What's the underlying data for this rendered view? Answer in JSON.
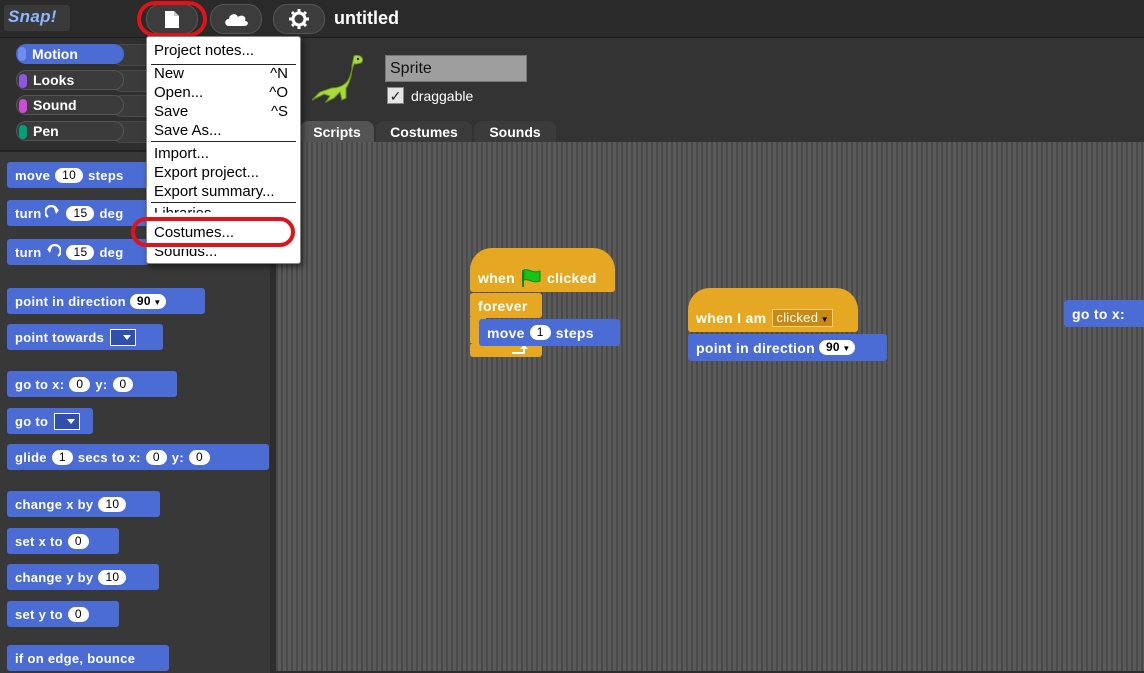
{
  "app": {
    "logo": "Snap!",
    "project_title": "untitled"
  },
  "categories": [
    {
      "label": "Motion",
      "color": "#4a6cd4"
    },
    {
      "label": "Looks",
      "color": "#8f56e3"
    },
    {
      "label": "Sound",
      "color": "#cf4ad9"
    },
    {
      "label": "Pen",
      "color": "#00a178"
    }
  ],
  "palette": {
    "move": {
      "a": "move",
      "n": "10",
      "b": "steps"
    },
    "turn_cw": {
      "a": "turn",
      "n": "15",
      "b": "deg"
    },
    "turn_ccw": {
      "a": "turn",
      "n": "15",
      "b": "deg"
    },
    "point_dir": {
      "a": "point in direction",
      "n": "90"
    },
    "point_towards": {
      "a": "point towards"
    },
    "goto_xy": {
      "a": "go to x:",
      "x": "0",
      "b": "y:",
      "y": "0"
    },
    "goto": {
      "a": "go to"
    },
    "glide": {
      "a": "glide",
      "s": "1",
      "b": "secs to x:",
      "x": "0",
      "c": "y:",
      "y": "0"
    },
    "change_x": {
      "a": "change x by",
      "n": "10"
    },
    "set_x": {
      "a": "set x to",
      "n": "0"
    },
    "change_y": {
      "a": "change y by",
      "n": "10"
    },
    "set_y": {
      "a": "set y to",
      "n": "0"
    },
    "bounce": {
      "a": "if on edge, bounce"
    }
  },
  "sprite": {
    "name": "Sprite",
    "draggable_label": "draggable",
    "draggable_checked": "✓"
  },
  "tabs": [
    "Scripts",
    "Costumes",
    "Sounds"
  ],
  "scripts": {
    "flag_hat": {
      "a": "when",
      "b": "clicked"
    },
    "forever": "forever",
    "move": {
      "a": "move",
      "n": "1",
      "b": "steps"
    },
    "when_i_am": {
      "a": "when I am",
      "opt": "clicked"
    },
    "point_dir": {
      "a": "point in direction",
      "n": "90"
    },
    "goto_partial": "go to x:"
  },
  "menu": {
    "items": [
      {
        "label": "Project notes..."
      },
      {
        "label": "New",
        "key": "^N"
      },
      {
        "label": "Open...",
        "key": "^O"
      },
      {
        "label": "Save",
        "key": "^S"
      },
      {
        "label": "Save As..."
      },
      {
        "label": "Import..."
      },
      {
        "label": "Export project..."
      },
      {
        "label": "Export summary..."
      },
      {
        "label": "Libraries..."
      },
      {
        "label": "Costumes..."
      },
      {
        "label": "Sounds..."
      }
    ]
  }
}
